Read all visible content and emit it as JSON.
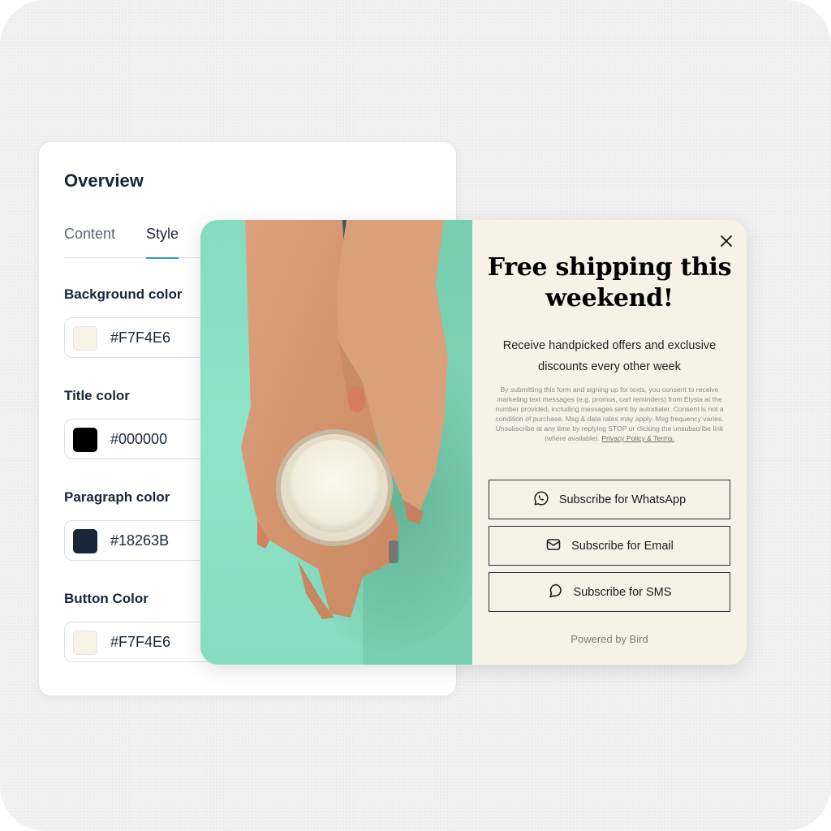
{
  "settings_panel": {
    "title": "Overview",
    "tabs": [
      {
        "label": "Content",
        "active": false
      },
      {
        "label": "Style",
        "active": true
      }
    ],
    "fields": [
      {
        "label": "Background color",
        "value": "#F7F4E6",
        "swatch": "#F7F4E6"
      },
      {
        "label": "Title color",
        "value": "#000000",
        "swatch": "#000000"
      },
      {
        "label": "Paragraph color",
        "value": "#18263B",
        "swatch": "#18263B"
      },
      {
        "label": "Button Color",
        "value": "#F7F4E6",
        "swatch": "#F7F4E6"
      }
    ],
    "accent_color": "#2B95E8"
  },
  "popup": {
    "image_alt": "Hands holding a jar of cream on a mint green background",
    "title": "Free shipping this weekend!",
    "subtitle": "Receive handpicked offers and exclusive discounts every other week",
    "legal_text": "By submitting this form and signing up for texts, you consent to receive marketing text messages (e.g. promos, cart reminders) from Elysia at the number provided, including messages sent by autodialer. Consent is not a condition of purchase. Msg & data rates may apply. Msg frequency varies. Unsubscribe at any time by replying STOP or clicking the unsubscribe link (where available).",
    "legal_link": "Privacy Policy & Terms.",
    "buttons": [
      {
        "label": "Subscribe for WhatsApp",
        "icon": "whatsapp-icon"
      },
      {
        "label": "Subscribe for Email",
        "icon": "mail-icon"
      },
      {
        "label": "Subscribe for SMS",
        "icon": "chat-bubble-icon"
      }
    ],
    "footer": "Powered by Bird",
    "close_icon": "close-icon",
    "background_color": "#F7F4E6"
  }
}
